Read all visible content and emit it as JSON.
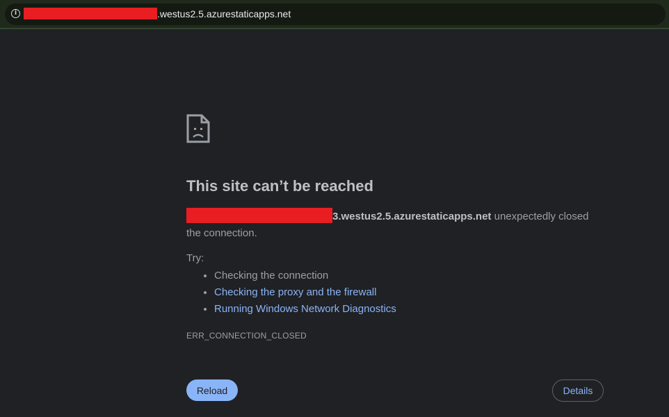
{
  "address_bar": {
    "url_visible": ".westus2.5.azurestaticapps.net",
    "info_icon": "info-icon"
  },
  "error_page": {
    "icon": "sad-page-icon",
    "title": "This site can’t be reached",
    "host_visible": "3.westus2.5.azurestaticapps.net",
    "description_suffix": " unexpectedly closed the connection.",
    "try_label": "Try:",
    "suggestions": [
      {
        "label": "Checking the connection",
        "link": false
      },
      {
        "label": "Checking the proxy and the firewall",
        "link": true
      },
      {
        "label": "Running Windows Network Diagnostics",
        "link": true
      }
    ],
    "error_code": "ERR_CONNECTION_CLOSED",
    "reload_label": "Reload",
    "details_label": "Details"
  },
  "colors": {
    "background": "#202124",
    "link": "#8ab4f8",
    "redaction": "#e81e22"
  }
}
